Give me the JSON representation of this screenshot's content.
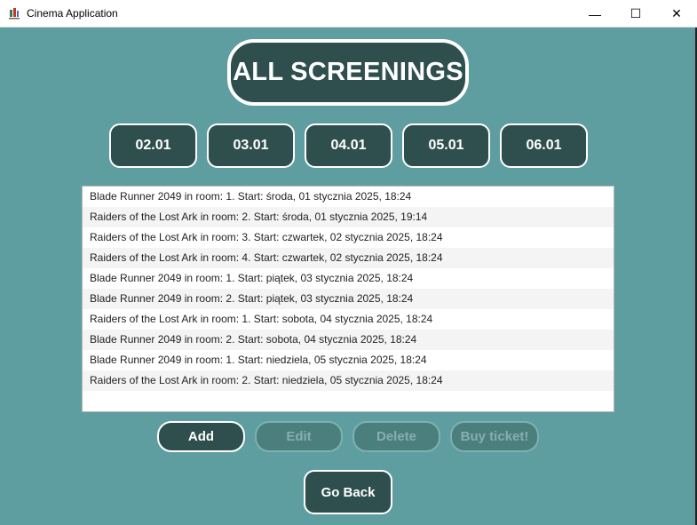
{
  "window": {
    "title": "Cinema Application",
    "icon": "cinema-app-icon",
    "controls": {
      "minimize": "—",
      "maximize": "☐",
      "close": "✕"
    }
  },
  "header": {
    "title": "ALL SCREENINGS"
  },
  "dates": [
    "02.01",
    "03.01",
    "04.01",
    "05.01",
    "06.01"
  ],
  "screenings": [
    "Blade Runner 2049 in room: 1. Start: środa, 01 stycznia 2025, 18:24",
    "Raiders of the Lost Ark in room: 2. Start: środa, 01 stycznia 2025, 19:14",
    "Raiders of the Lost Ark in room: 3. Start: czwartek, 02 stycznia 2025, 18:24",
    "Raiders of the Lost Ark in room: 4. Start: czwartek, 02 stycznia 2025, 18:24",
    "Blade Runner 2049 in room: 1. Start: piątek, 03 stycznia 2025, 18:24",
    "Blade Runner 2049 in room: 2. Start: piątek, 03 stycznia 2025, 18:24",
    "Raiders of the Lost Ark in room: 1. Start: sobota, 04 stycznia 2025, 18:24",
    "Blade Runner 2049 in room: 2. Start: sobota, 04 stycznia 2025, 18:24",
    "Blade Runner 2049 in room: 1. Start: niedziela, 05 stycznia 2025, 18:24",
    "Raiders of the Lost Ark in room: 2. Start: niedziela, 05 stycznia 2025, 18:24"
  ],
  "actions": {
    "add": "Add",
    "edit": "Edit",
    "delete": "Delete",
    "buy": "Buy ticket!"
  },
  "go_back": "Go Back",
  "colors": {
    "background": "#5f9ea0",
    "button": "#2f4f4f",
    "button_text": "#ffffff",
    "disabled_button": "#4b7f7e"
  }
}
